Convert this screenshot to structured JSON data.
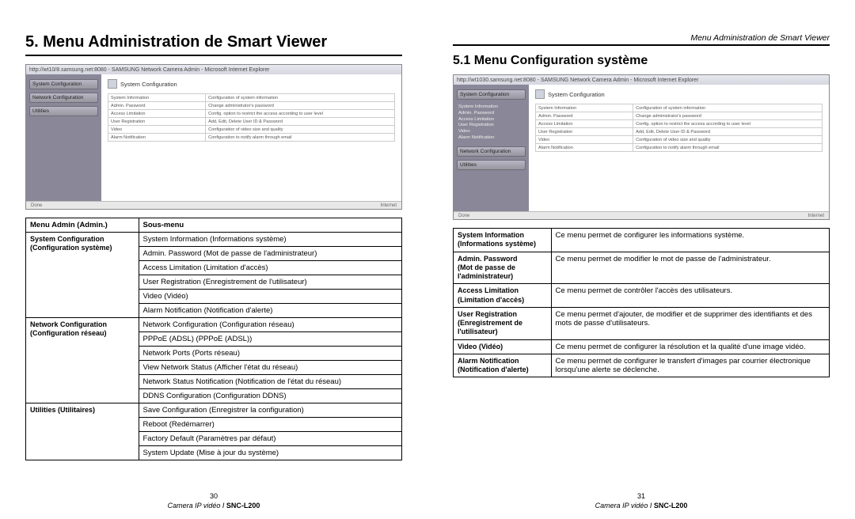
{
  "left": {
    "title": "5. Menu Administration de Smart Viewer",
    "shot": {
      "titlebar": "http://wt10/8.samsung.net:8080 - SAMSUNG Network Camera Admin - Microsoft Internet Explorer",
      "side_btn1": "System Configuration",
      "side_btn2": "Network Configuration",
      "side_btn3": "Utilities",
      "panel_title": "System Configuration",
      "rows": [
        [
          "System Information",
          "Configuration of system information"
        ],
        [
          "Admin. Password",
          "Change administrator's password"
        ],
        [
          "Access Limitation",
          "Config. option to restrict the access according to user level"
        ],
        [
          "User Registration",
          "Add, Edit, Delete User ID & Password"
        ],
        [
          "Video",
          "Configuration of video size and quality"
        ],
        [
          "Alarm Notification",
          "Configuration to notify alarm through email"
        ]
      ],
      "status_left": "Done",
      "status_right": "Internet"
    },
    "table": {
      "head0": "Menu Admin (Admin.)",
      "head1": "Sous-menu",
      "group0": {
        "label": "System Configuration\n(Configuration système)",
        "items": [
          "System Information (Informations système)",
          "Admin. Password (Mot de passe de l'administrateur)",
          "Access Limitation (Limitation d'accès)",
          "User Registration (Enregistrement de l'utilisateur)",
          "Video (Vidéo)",
          "Alarm Notification (Notification d'alerte)"
        ]
      },
      "group1": {
        "label": "Network Configuration\n(Configuration réseau)",
        "items": [
          "Network Configuration (Configuration réseau)",
          "PPPoE (ADSL) (PPPoE (ADSL))",
          "Network Ports (Ports réseau)",
          "View Network Status (Afficher l'état du réseau)",
          "Network Status Notification (Notification de l'état du réseau)",
          "DDNS Configuration (Configuration DDNS)"
        ]
      },
      "group2": {
        "label": "Utilities (Utilitaires)",
        "items": [
          "Save Configuration (Enregistrer la configuration)",
          "Reboot (Redémarrer)",
          "Factory Default (Paramètres par défaut)",
          "System Update (Mise à jour du système)"
        ]
      }
    },
    "pagenum": "30",
    "footer_prefix": "Camera IP vidéo I ",
    "footer_model": "SNC-L200"
  },
  "right": {
    "header": "Menu Administration de Smart Viewer",
    "title": "5.1 Menu Configuration système",
    "shot": {
      "titlebar": "http://wt1030.samsung.net:8080 - SAMSUNG Network Camera Admin - Microsoft Internet Explorer",
      "side_btn1": "System Configuration",
      "side_list": [
        "System Information",
        "Admin. Password",
        "Access Limitation",
        "User Registration",
        "Video",
        "Alarm Notification"
      ],
      "side_btn2": "Network Configuration",
      "side_btn3": "Utilities",
      "panel_title": "System Configuration",
      "rows": [
        [
          "System Information",
          "Configuration of system information"
        ],
        [
          "Admin. Password",
          "Change administrator's password"
        ],
        [
          "Access Limitation",
          "Config. option to restrict the access according to user level"
        ],
        [
          "User Registration",
          "Add, Edit, Delete User ID & Password"
        ],
        [
          "Video",
          "Configuration of video size and quality"
        ],
        [
          "Alarm Notification",
          "Configuration to notify alarm through email"
        ]
      ],
      "status_left": "Done",
      "status_right": "Internet"
    },
    "table": [
      {
        "label": "System Information\n(Informations système)",
        "desc": "Ce menu permet de configurer les informations système."
      },
      {
        "label": "Admin. Password\n(Mot de passe de\nl'administrateur)",
        "desc": "Ce menu permet de modifier le mot de passe de l'administrateur."
      },
      {
        "label": "Access Limitation\n(Limitation d'accès)",
        "desc": "Ce menu permet de contrôler l'accès des utilisateurs."
      },
      {
        "label": "User Registration\n(Enregistrement de\nl'utilisateur)",
        "desc": "Ce menu permet d'ajouter, de modifier et de supprimer des identifiants et des mots de passe d'utilisateurs."
      },
      {
        "label": "Video (Vidéo)",
        "desc": "Ce menu permet de configurer la résolution et la qualité d'une image vidéo."
      },
      {
        "label": "Alarm Notification\n(Notification d'alerte)",
        "desc": "Ce menu permet de configurer le transfert d'images par courrier électronique lorsqu'une alerte se déclenche."
      }
    ],
    "pagenum": "31",
    "footer_prefix": "Camera IP vidéo I ",
    "footer_model": "SNC-L200"
  }
}
